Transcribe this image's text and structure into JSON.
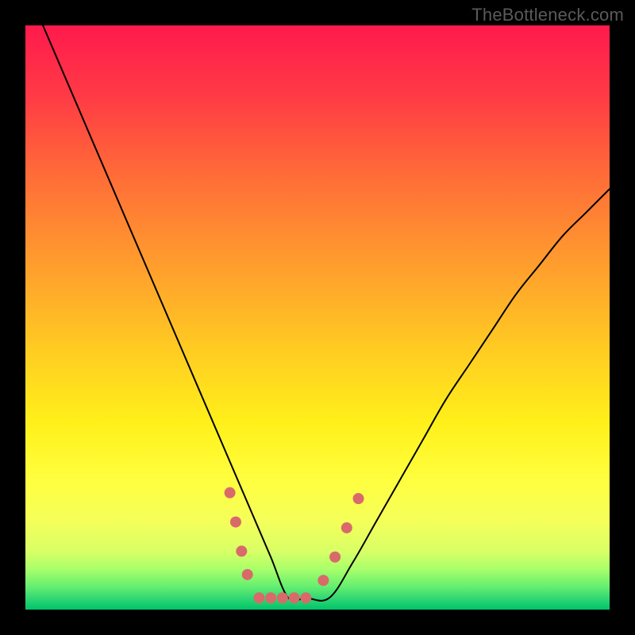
{
  "watermark": "TheBottleneck.com",
  "chart_data": {
    "type": "line",
    "title": "",
    "xlabel": "",
    "ylabel": "",
    "xlim": [
      0,
      100
    ],
    "ylim": [
      0,
      100
    ],
    "grid": false,
    "legend": false,
    "background_gradient": [
      "#ff1a4d",
      "#ff5a3c",
      "#ff9a2e",
      "#ffd91f",
      "#ffff33",
      "#e6ff66",
      "#99ff66",
      "#33e673",
      "#00c46a"
    ],
    "series": [
      {
        "name": "bottleneck-curve",
        "x": [
          3,
          6,
          9,
          12,
          15,
          18,
          21,
          24,
          27,
          30,
          33,
          36,
          39,
          42,
          45,
          48,
          52,
          56,
          60,
          64,
          68,
          72,
          76,
          80,
          84,
          88,
          92,
          96,
          100
        ],
        "y": [
          100,
          93,
          86,
          79,
          72,
          65,
          58,
          51,
          44,
          37,
          30,
          23,
          16,
          9,
          2,
          2,
          2,
          8,
          15,
          22,
          29,
          36,
          42,
          48,
          54,
          59,
          64,
          68,
          72
        ],
        "color": "#000000",
        "stroke_width": 2
      },
      {
        "name": "marker-cluster-left",
        "type": "scatter",
        "x": [
          35,
          36,
          37,
          38
        ],
        "y": [
          20,
          15,
          10,
          6
        ],
        "color": "#d96a6a",
        "size": 14
      },
      {
        "name": "marker-cluster-bottom",
        "type": "scatter",
        "x": [
          40,
          42,
          44,
          46,
          48
        ],
        "y": [
          2,
          2,
          2,
          2,
          2
        ],
        "color": "#d96a6a",
        "size": 14
      },
      {
        "name": "marker-cluster-right",
        "type": "scatter",
        "x": [
          51,
          53,
          55,
          57
        ],
        "y": [
          5,
          9,
          14,
          19
        ],
        "color": "#d96a6a",
        "size": 14
      }
    ]
  }
}
